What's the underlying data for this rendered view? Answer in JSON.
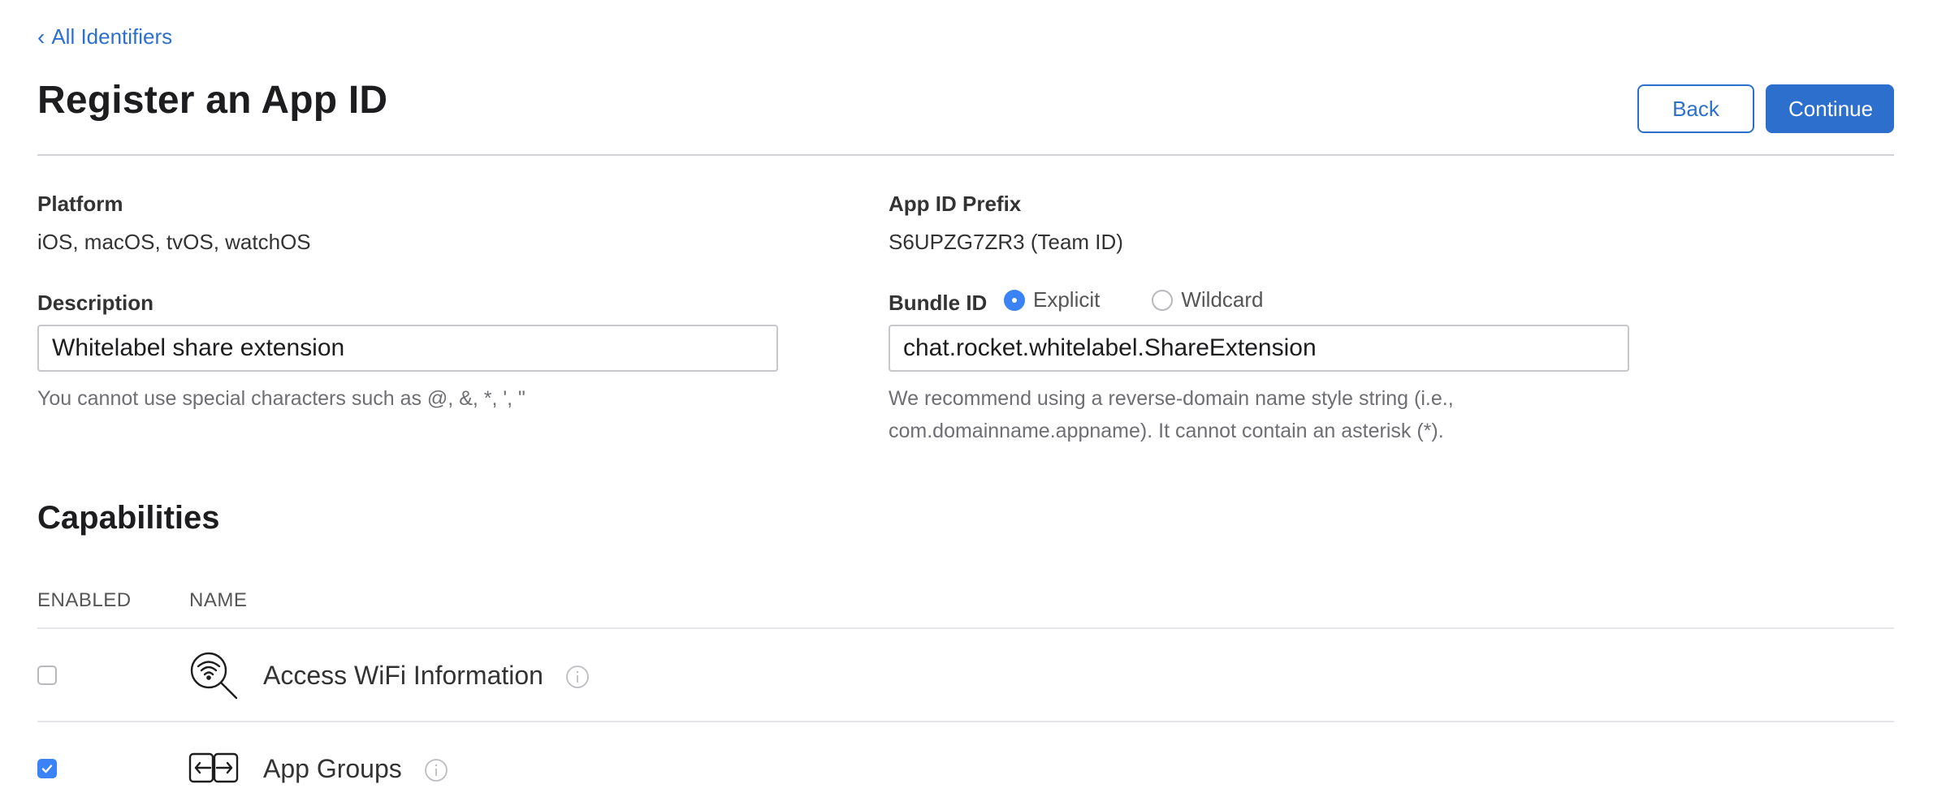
{
  "nav": {
    "back_link": "All Identifiers",
    "back_chevron": "‹"
  },
  "header": {
    "title": "Register an App ID",
    "back_label": "Back",
    "continue_label": "Continue"
  },
  "platform": {
    "label": "Platform",
    "value": "iOS, macOS, tvOS, watchOS"
  },
  "prefix": {
    "label": "App ID Prefix",
    "value": "S6UPZG7ZR3 (Team ID)"
  },
  "description": {
    "label": "Description",
    "value": "Whitelabel share extension",
    "hint": "You cannot use special characters such as @, &, *, ', \""
  },
  "bundle": {
    "label": "Bundle ID",
    "options": [
      {
        "label": "Explicit",
        "selected": true
      },
      {
        "label": "Wildcard",
        "selected": false
      }
    ],
    "value": "chat.rocket.whitelabel.ShareExtension",
    "hint_line1": "We recommend using a reverse-domain name style string (i.e.,",
    "hint_line2": "com.domainname.appname). It cannot contain an asterisk (*)."
  },
  "capabilities": {
    "title": "Capabilities",
    "columns": {
      "enabled": "ENABLED",
      "name": "NAME"
    },
    "rows": [
      {
        "name": "Access WiFi Information",
        "enabled": false,
        "icon": "wifi-search-icon"
      },
      {
        "name": "App Groups",
        "enabled": true,
        "icon": "app-groups-icon"
      }
    ]
  },
  "colors": {
    "accent": "#2d6fcc",
    "checkbox_on": "#3a82f6"
  }
}
